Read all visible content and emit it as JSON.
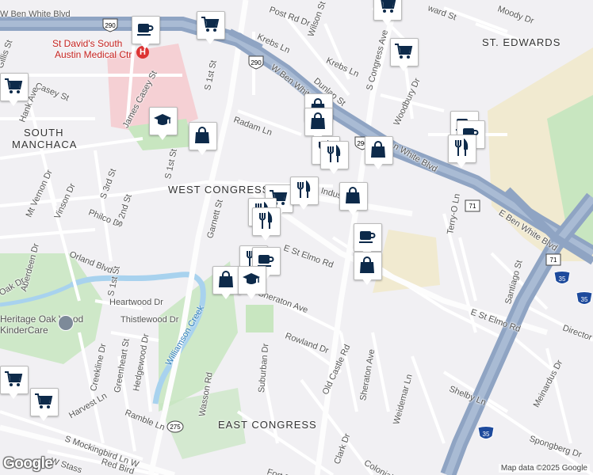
{
  "map": {
    "neighborhoods": [
      {
        "id": "st-edwards",
        "text": "ST. EDWARDS"
      },
      {
        "id": "south-manchaca-1",
        "text": "SOUTH"
      },
      {
        "id": "south-manchaca-2",
        "text": "MANCHACA"
      },
      {
        "id": "west-congress",
        "text": "WEST CONGRESS"
      },
      {
        "id": "east-congress",
        "text": "EAST CONGRESS"
      }
    ],
    "streets": [
      {
        "id": "w-ben-white-top",
        "text": "W Ben White Blvd"
      },
      {
        "id": "w-ben-white-mid",
        "text": "W Ben White Blvd"
      },
      {
        "id": "e-ben-white",
        "text": "E Ben White Blvd"
      },
      {
        "id": "n-ben-white",
        "text": "n White Blvd"
      },
      {
        "id": "post-rd",
        "text": "Post Rd Dr"
      },
      {
        "id": "wilson",
        "text": "Wilson St"
      },
      {
        "id": "krebs-1",
        "text": "Krebs Ln"
      },
      {
        "id": "krebs-2",
        "text": "Krebs Ln"
      },
      {
        "id": "dunlap",
        "text": "Dunlap St"
      },
      {
        "id": "s-congress",
        "text": "S Congress Ave"
      },
      {
        "id": "moody",
        "text": "Moody Dr"
      },
      {
        "id": "ward",
        "text": "ward St"
      },
      {
        "id": "woodbury",
        "text": "Woodbury Dr"
      },
      {
        "id": "radam",
        "text": "Radam Ln"
      },
      {
        "id": "s-1st-a",
        "text": "S 1st St"
      },
      {
        "id": "s-1st-b",
        "text": "S 1st St"
      },
      {
        "id": "s-1st-c",
        "text": "S 1st St"
      },
      {
        "id": "james-casey",
        "text": "James Casey St"
      },
      {
        "id": "casey",
        "text": "Casey St"
      },
      {
        "id": "hank",
        "text": "Hank Ave"
      },
      {
        "id": "gillis",
        "text": "Gillis St"
      },
      {
        "id": "mt-vernon",
        "text": "Mt Vernon Dr"
      },
      {
        "id": "vinson",
        "text": "Vinson Dr"
      },
      {
        "id": "s-3rd",
        "text": "S 3rd St"
      },
      {
        "id": "philco",
        "text": "Philco Dr"
      },
      {
        "id": "s-2nd",
        "text": "S 2nd St"
      },
      {
        "id": "garnett",
        "text": "Garnett St"
      },
      {
        "id": "industrial",
        "text": "Indus"
      },
      {
        "id": "e-st-elmo-1",
        "text": "E St Elmo Rd"
      },
      {
        "id": "e-st-elmo-2",
        "text": "E St Elmo Rd"
      },
      {
        "id": "orland",
        "text": "Orland Blvd"
      },
      {
        "id": "aberdeen",
        "text": "Aberdeen Dr"
      },
      {
        "id": "oak",
        "text": "Oak Dr"
      },
      {
        "id": "heartwood",
        "text": "Heartwood Dr"
      },
      {
        "id": "thistlewood",
        "text": "Thistlewood Dr"
      },
      {
        "id": "sheraton-ave-1",
        "text": "Sheraton Ave"
      },
      {
        "id": "sheraton-ave-2",
        "text": "Sheraton Ave"
      },
      {
        "id": "rowland",
        "text": "Rowland Dr"
      },
      {
        "id": "creekline",
        "text": "Creekline Dr"
      },
      {
        "id": "greenheart",
        "text": "Greenheart St"
      },
      {
        "id": "hedgewood",
        "text": "Hedgewood Dr"
      },
      {
        "id": "ramble",
        "text": "Ramble Ln"
      },
      {
        "id": "harvest",
        "text": "Harvest Ln"
      },
      {
        "id": "w-mockingbird",
        "text": "S Mockingbird Ln W"
      },
      {
        "id": "red-bird",
        "text": "Red Bird"
      },
      {
        "id": "w-stassney",
        "text": "W Stass"
      },
      {
        "id": "wasson",
        "text": "Wasson Rd"
      },
      {
        "id": "suburban",
        "text": "Suburban Dr"
      },
      {
        "id": "old-castle",
        "text": "Old Castle Rd"
      },
      {
        "id": "weidemar",
        "text": "Weidemar Ln"
      },
      {
        "id": "shelby",
        "text": "Shelby Ln"
      },
      {
        "id": "terry-o",
        "text": "Terry-O Ln"
      },
      {
        "id": "santiago",
        "text": "Santiago St"
      },
      {
        "id": "meinardus",
        "text": "Meinardus Dr"
      },
      {
        "id": "spongberg",
        "text": "Spongberg Dr"
      },
      {
        "id": "director",
        "text": "Director"
      },
      {
        "id": "colonial",
        "text": "Colonial P"
      },
      {
        "id": "clark",
        "text": "Clark Dr"
      },
      {
        "id": "fort",
        "text": "Fort D"
      }
    ],
    "water_label": "Williamson Creek",
    "pois": [
      {
        "id": "st-davids-1",
        "text": "St David's South"
      },
      {
        "id": "st-davids-2",
        "text": "Austin Medical Ctr"
      },
      {
        "id": "harwood-1",
        "text": "Heritage Oak Wood"
      },
      {
        "id": "harwood-2",
        "text": "KinderCare"
      }
    ],
    "shields": [
      {
        "id": "us290-a",
        "text": "290"
      },
      {
        "id": "us290-b",
        "text": "290"
      },
      {
        "id": "us290-c",
        "text": "290"
      },
      {
        "id": "sh71-a",
        "text": "71"
      },
      {
        "id": "sh71-b",
        "text": "71"
      },
      {
        "id": "i35-a",
        "text": "35"
      },
      {
        "id": "i35-b",
        "text": "35"
      },
      {
        "id": "i35-c",
        "text": "35"
      },
      {
        "id": "fm275",
        "text": "275"
      }
    ],
    "markers": [
      {
        "id": "m1",
        "icon": "coffee-icon"
      },
      {
        "id": "m2",
        "icon": "shopping-cart-icon"
      },
      {
        "id": "m3",
        "icon": "shopping-cart-icon"
      },
      {
        "id": "m4",
        "icon": "shopping-cart-icon"
      },
      {
        "id": "m5",
        "icon": "school-icon"
      },
      {
        "id": "m6",
        "icon": "shopping-bag-icon"
      },
      {
        "id": "m7",
        "icon": "shopping-bag-icon"
      },
      {
        "id": "m8",
        "icon": "shopping-bag-icon"
      },
      {
        "id": "m9",
        "icon": "restaurant-icon"
      },
      {
        "id": "m10",
        "icon": "restaurant-icon"
      },
      {
        "id": "m11",
        "icon": "shopping-bag-icon"
      },
      {
        "id": "m12",
        "icon": "coffee-icon"
      },
      {
        "id": "m13",
        "icon": "coffee-icon"
      },
      {
        "id": "m14",
        "icon": "restaurant-icon"
      },
      {
        "id": "m15",
        "icon": "shopping-bag-icon"
      },
      {
        "id": "m16",
        "icon": "shopping-cart-icon"
      },
      {
        "id": "m17",
        "icon": "restaurant-icon"
      },
      {
        "id": "m18",
        "icon": "restaurant-icon"
      },
      {
        "id": "m19",
        "icon": "restaurant-icon"
      },
      {
        "id": "m20",
        "icon": "restaurant-icon"
      },
      {
        "id": "m21",
        "icon": "coffee-icon"
      },
      {
        "id": "m22",
        "icon": "coffee-icon"
      },
      {
        "id": "m23",
        "icon": "shopping-bag-icon"
      },
      {
        "id": "m24",
        "icon": "shopping-bag-icon"
      },
      {
        "id": "m25",
        "icon": "school-icon"
      },
      {
        "id": "m26",
        "icon": "shopping-cart-icon"
      },
      {
        "id": "m27",
        "icon": "shopping-cart-icon"
      },
      {
        "id": "m28",
        "icon": "shopping-cart-icon"
      }
    ],
    "logo": "Google",
    "attribution": "Map data ©2025 Google",
    "colors": {
      "background": "#f1f0f3",
      "highway": "#8fa4c3",
      "park": "#c8e6c0",
      "medical": "#f5d0d4",
      "campus": "#f1ead0",
      "water": "#a8d2ee",
      "marker_icon": "#0d2a4a"
    }
  }
}
